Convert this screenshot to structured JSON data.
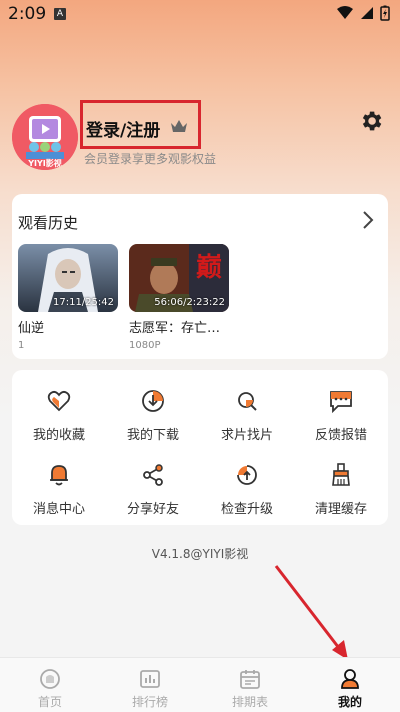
{
  "status_bar": {
    "time": "2:09",
    "notif_letter": "A"
  },
  "profile": {
    "avatar_text": "YIYI影视",
    "login_label": "登录/注册",
    "subtitle": "会员登录享更多观影权益"
  },
  "history": {
    "title": "观看历史",
    "items": [
      {
        "title": "仙逆",
        "time": "17:11/25:42",
        "sub": "1"
      },
      {
        "title": "志愿军：存亡…",
        "time": "56:06/2:23:22",
        "sub": "1080P"
      }
    ]
  },
  "menu": {
    "items": [
      {
        "label": "我的收藏",
        "icon": "heart-icon"
      },
      {
        "label": "我的下载",
        "icon": "download-icon"
      },
      {
        "label": "求片找片",
        "icon": "search-film-icon"
      },
      {
        "label": "反馈报错",
        "icon": "feedback-icon"
      },
      {
        "label": "消息中心",
        "icon": "bell-icon"
      },
      {
        "label": "分享好友",
        "icon": "share-icon"
      },
      {
        "label": "检查升级",
        "icon": "upgrade-icon"
      },
      {
        "label": "清理缓存",
        "icon": "broom-icon"
      }
    ]
  },
  "version": "V4.1.8@YIYI影视",
  "tabbar": {
    "tabs": [
      {
        "label": "首页",
        "icon": "home-icon"
      },
      {
        "label": "排行榜",
        "icon": "ranking-icon"
      },
      {
        "label": "排期表",
        "icon": "calendar-icon"
      },
      {
        "label": "我的",
        "icon": "profile-icon"
      }
    ],
    "active_index": 3
  },
  "colors": {
    "accent": "#f07a33",
    "annotation_red": "#d8262e"
  }
}
